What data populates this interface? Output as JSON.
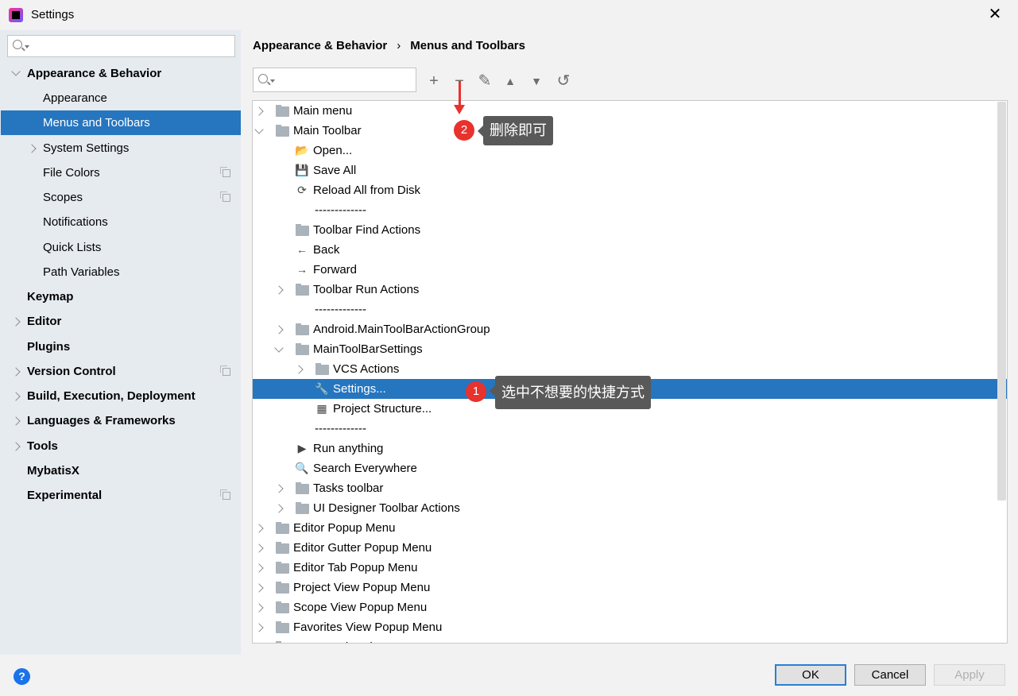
{
  "window": {
    "title": "Settings",
    "close": "✕"
  },
  "sidebar": {
    "search_placeholder": "",
    "items": [
      {
        "label": "Appearance & Behavior",
        "level": 0,
        "exp": "open",
        "bold": true
      },
      {
        "label": "Appearance",
        "level": 1
      },
      {
        "label": "Menus and Toolbars",
        "level": 1,
        "selected": true
      },
      {
        "label": "System Settings",
        "level": 1,
        "exp": "closed"
      },
      {
        "label": "File Colors",
        "level": 1,
        "copy": true
      },
      {
        "label": "Scopes",
        "level": 1,
        "copy": true
      },
      {
        "label": "Notifications",
        "level": 1
      },
      {
        "label": "Quick Lists",
        "level": 1
      },
      {
        "label": "Path Variables",
        "level": 1
      },
      {
        "label": "Keymap",
        "level": 0,
        "bold": true
      },
      {
        "label": "Editor",
        "level": 0,
        "exp": "closed",
        "bold": true
      },
      {
        "label": "Plugins",
        "level": 0,
        "bold": true
      },
      {
        "label": "Version Control",
        "level": 0,
        "exp": "closed",
        "bold": true,
        "copy": true
      },
      {
        "label": "Build, Execution, Deployment",
        "level": 0,
        "exp": "closed",
        "bold": true
      },
      {
        "label": "Languages & Frameworks",
        "level": 0,
        "exp": "closed",
        "bold": true
      },
      {
        "label": "Tools",
        "level": 0,
        "exp": "closed",
        "bold": true
      },
      {
        "label": "MybatisX",
        "level": 0,
        "bold": true
      },
      {
        "label": "Experimental",
        "level": 0,
        "bold": true,
        "copy": true
      }
    ]
  },
  "breadcrumb": {
    "parent": "Appearance & Behavior",
    "separator": "›",
    "current": "Menus and Toolbars"
  },
  "toolbar": {
    "search_placeholder": "",
    "buttons": [
      {
        "name": "add-button",
        "glyph": "+"
      },
      {
        "name": "remove-button",
        "glyph": "−"
      },
      {
        "name": "edit-button",
        "glyph": "✎"
      },
      {
        "name": "move-up-button",
        "glyph": "▲"
      },
      {
        "name": "move-down-button",
        "glyph": "▼"
      },
      {
        "name": "restore-button",
        "glyph": "↺"
      }
    ]
  },
  "tree": [
    {
      "label": "Main menu",
      "level": 0,
      "exp": "closed",
      "icon": "folder"
    },
    {
      "label": "Main Toolbar",
      "level": 0,
      "exp": "open",
      "icon": "folder"
    },
    {
      "label": "Open...",
      "level": 1,
      "icon": "open-folder",
      "glyph": "📂"
    },
    {
      "label": "Save All",
      "level": 1,
      "icon": "save",
      "glyph": "💾"
    },
    {
      "label": "Reload All from Disk",
      "level": 1,
      "icon": "reload",
      "glyph": "⟳"
    },
    {
      "label": "-------------",
      "level": 1
    },
    {
      "label": "Toolbar Find Actions",
      "level": 1,
      "icon": "folder"
    },
    {
      "label": "Back",
      "level": 1,
      "icon": "arrow-left",
      "glyph": "←"
    },
    {
      "label": "Forward",
      "level": 1,
      "icon": "arrow-right",
      "glyph": "→"
    },
    {
      "label": "Toolbar Run Actions",
      "level": 1,
      "exp": "closed",
      "icon": "folder"
    },
    {
      "label": "-------------",
      "level": 1
    },
    {
      "label": "Android.MainToolBarActionGroup",
      "level": 1,
      "exp": "closed",
      "icon": "folder"
    },
    {
      "label": "MainToolBarSettings",
      "level": 1,
      "exp": "open",
      "icon": "folder"
    },
    {
      "label": "VCS Actions",
      "level": 2,
      "exp": "closed",
      "icon": "folder"
    },
    {
      "label": "Settings...",
      "level": 2,
      "icon": "wrench",
      "glyph": "🔧",
      "selected": true
    },
    {
      "label": "Project Structure...",
      "level": 2,
      "icon": "project-structure",
      "glyph": "▦"
    },
    {
      "label": "-------------",
      "level": 1
    },
    {
      "label": "Run anything",
      "level": 1,
      "icon": "run-anything",
      "glyph": "▶"
    },
    {
      "label": "Search Everywhere",
      "level": 1,
      "icon": "search",
      "glyph": "🔍"
    },
    {
      "label": "Tasks toolbar",
      "level": 1,
      "exp": "closed",
      "icon": "folder"
    },
    {
      "label": "UI Designer Toolbar Actions",
      "level": 1,
      "exp": "closed",
      "icon": "folder"
    },
    {
      "label": "Editor Popup Menu",
      "level": 0,
      "exp": "closed",
      "icon": "folder"
    },
    {
      "label": "Editor Gutter Popup Menu",
      "level": 0,
      "exp": "closed",
      "icon": "folder"
    },
    {
      "label": "Editor Tab Popup Menu",
      "level": 0,
      "exp": "closed",
      "icon": "folder"
    },
    {
      "label": "Project View Popup Menu",
      "level": 0,
      "exp": "closed",
      "icon": "folder"
    },
    {
      "label": "Scope View Popup Menu",
      "level": 0,
      "exp": "closed",
      "icon": "folder"
    },
    {
      "label": "Favorites View Popup Menu",
      "level": 0,
      "exp": "closed",
      "icon": "folder"
    },
    {
      "label": "Commander View Popup Menu",
      "level": 0,
      "exp": "closed",
      "icon": "folder"
    }
  ],
  "annotations": {
    "step1_num": "1",
    "step1_text": "选中不想要的快捷方式",
    "step2_num": "2",
    "step2_text": "删除即可",
    "color": "#e8322d"
  },
  "footer": {
    "help": "?",
    "ok": "OK",
    "cancel": "Cancel",
    "apply": "Apply"
  },
  "colors": {
    "selection": "#2675bf",
    "sidebar_bg": "#e6ebf0"
  }
}
